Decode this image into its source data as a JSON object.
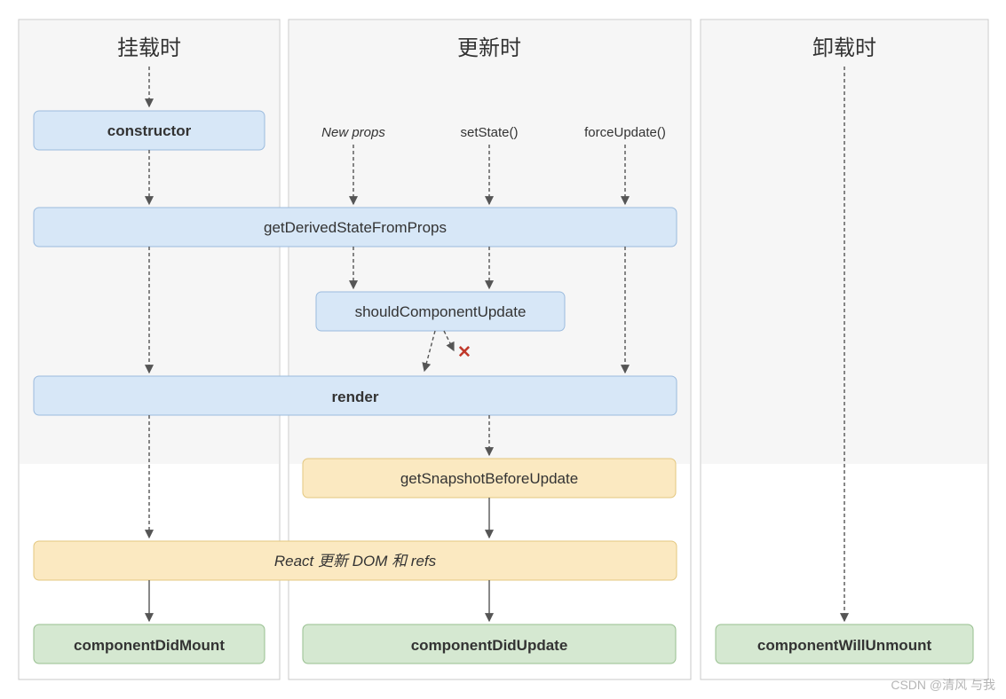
{
  "columns": {
    "mounting": "挂载时",
    "updating": "更新时",
    "unmounting": "卸载时"
  },
  "triggers": {
    "newProps": "New props",
    "setState": "setState()",
    "forceUpdate": "forceUpdate()"
  },
  "methods": {
    "constructor": "constructor",
    "gdsfp": "getDerivedStateFromProps",
    "scu": "shouldComponentUpdate",
    "render": "render",
    "gsbu": "getSnapshotBeforeUpdate",
    "commit": "React 更新 DOM 和 refs",
    "cdm": "componentDidMount",
    "cdu": "componentDidUpdate",
    "cwu": "componentWillUnmount"
  },
  "icons": {
    "cross": "✕"
  },
  "watermark": "CSDN @清风 与我"
}
